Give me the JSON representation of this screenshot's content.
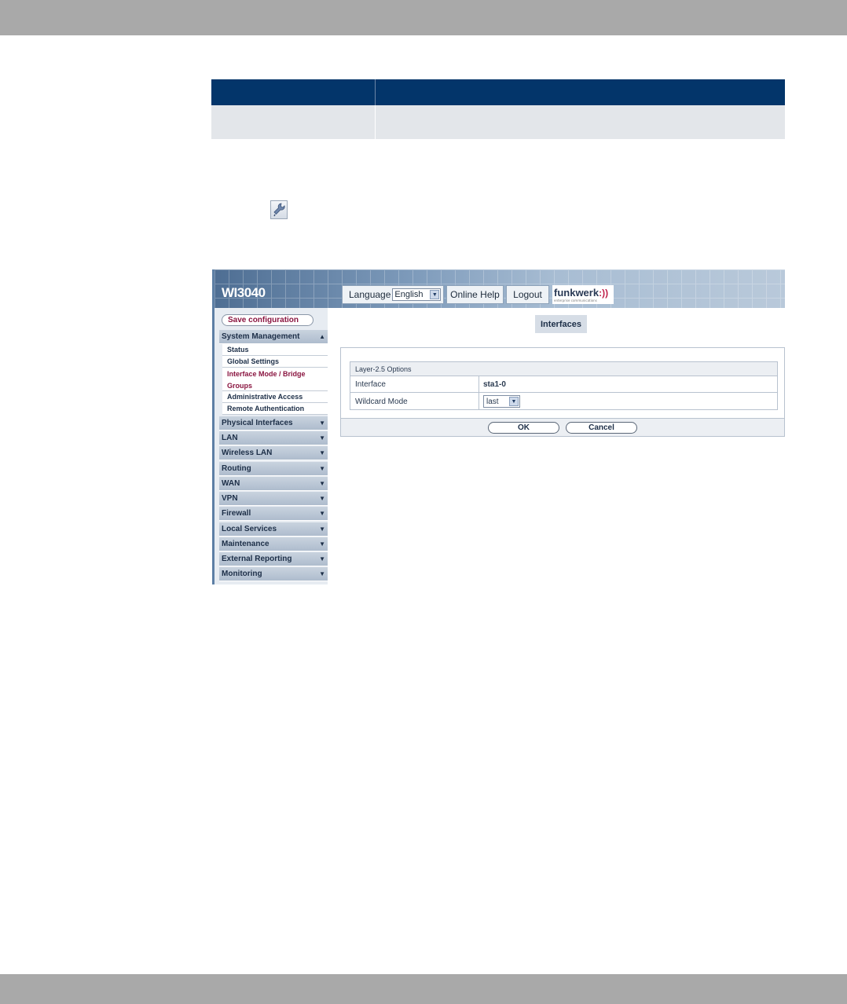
{
  "header": {
    "device_name": "WI3040",
    "language_label": "Language",
    "language_value": "English",
    "online_help": "Online Help",
    "logout": "Logout",
    "brand_name": "funkwerk",
    "brand_waves": ":))",
    "brand_tagline": "enterprise communications"
  },
  "sidebar": {
    "save_configuration": "Save configuration",
    "system_management": "System Management",
    "sub_items": [
      "Status",
      "Global Settings",
      "Interface Mode / Bridge Groups",
      "Administrative Access",
      "Remote Authentication"
    ],
    "menus": [
      "Physical Interfaces",
      "LAN",
      "Wireless LAN",
      "Routing",
      "WAN",
      "VPN",
      "Firewall",
      "Local Services",
      "Maintenance",
      "External Reporting",
      "Monitoring"
    ]
  },
  "main": {
    "title": "Interfaces",
    "fieldset_legend": "Layer-2.5 Options",
    "interface_label": "Interface",
    "interface_value": "sta1-0",
    "wildcard_label": "Wildcard Mode",
    "wildcard_value": "last",
    "ok": "OK",
    "cancel": "Cancel"
  },
  "colors": {
    "table_header": "#03356a",
    "table_row": "#e3e6ea",
    "accent_text": "#8a1540"
  }
}
